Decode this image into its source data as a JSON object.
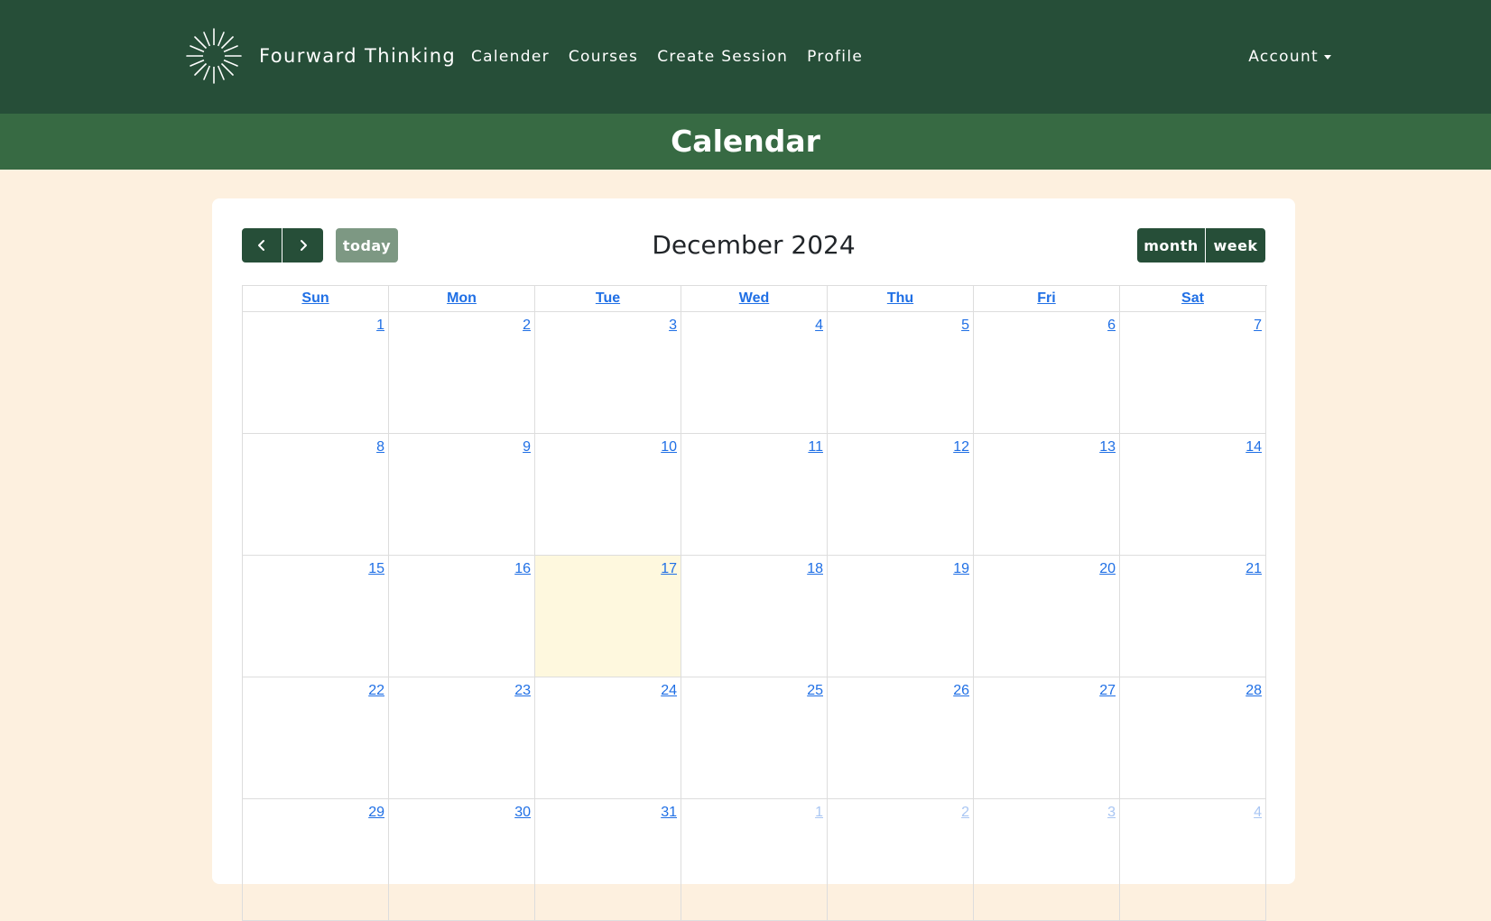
{
  "app": {
    "brand": "Fourward Thinking"
  },
  "nav": {
    "links": [
      "Calender",
      "Courses",
      "Create Session",
      "Profile"
    ],
    "account": "Account"
  },
  "page": {
    "title": "Calendar"
  },
  "calendar": {
    "title": "December 2024",
    "buttons": {
      "today": "today",
      "month": "month",
      "week": "week"
    },
    "weekdays": [
      "Sun",
      "Mon",
      "Tue",
      "Wed",
      "Thu",
      "Fri",
      "Sat"
    ],
    "weeks": [
      [
        "1",
        "2",
        "3",
        "4",
        "5",
        "6",
        "7"
      ],
      [
        "8",
        "9",
        "10",
        "11",
        "12",
        "13",
        "14"
      ],
      [
        "15",
        "16",
        "17",
        "18",
        "19",
        "20",
        "21"
      ],
      [
        "22",
        "23",
        "24",
        "25",
        "26",
        "27",
        "28"
      ],
      [
        "29",
        "30",
        "31",
        "1",
        "2",
        "3",
        "4"
      ]
    ],
    "today_date": "17",
    "colors": {
      "nav": "#264e38",
      "title_bar": "#376a43",
      "background": "#fdf0df",
      "link": "#1f6fe5",
      "today_highlight": "#fef8de",
      "today_button": "#7d9883"
    }
  }
}
